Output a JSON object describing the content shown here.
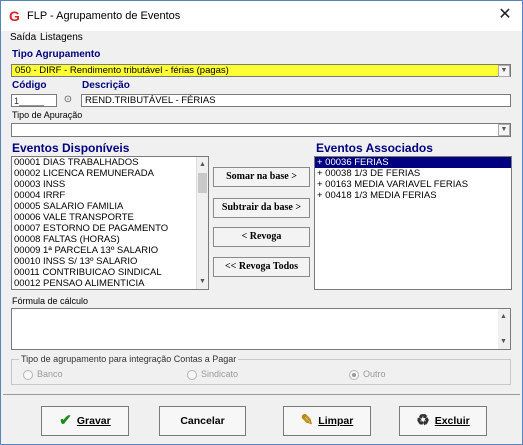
{
  "window": {
    "title": "FLP - Agrupamento de Eventos",
    "app_icon": "G",
    "close_glyph": "✕"
  },
  "menu": {
    "items": [
      "Saída",
      "Listagens"
    ]
  },
  "tipo_agrupamento": {
    "label": "Tipo Agrupamento",
    "value": "050 - DIRF - Rendimento tributável - férias (pagas)"
  },
  "codigo": {
    "label": "Código",
    "value": "1_____"
  },
  "descricao": {
    "label": "Descrição",
    "value": "REND.TRIBUTÁVEL - FÉRIAS"
  },
  "tipo_apuracao": {
    "label": "Tipo de Apuração",
    "value": ""
  },
  "eventos_disponiveis": {
    "title": "Eventos Disponíveis",
    "items": [
      "00001 DIAS TRABALHADOS",
      "00002 LICENCA REMUNERADA",
      "00003 INSS",
      "00004 IRRF",
      "00005 SALARIO FAMILIA",
      "00006 VALE TRANSPORTE",
      "00007 ESTORNO DE PAGAMENTO",
      "00008 FALTAS (HORAS)",
      "00009 1ª PARCELA 13º SALARIO",
      "00010 INSS S/ 13º SALARIO",
      "00011 CONTRIBUICAO SINDICAL",
      "00012 PENSAO ALIMENTICIA"
    ]
  },
  "eventos_associados": {
    "title": "Eventos Associados",
    "items": [
      "+ 00036 FERIAS",
      "+ 00038 1/3 DE FERIAS",
      "+ 00163 MEDIA VARIAVEL FERIAS",
      "+ 00418 1/3 MEDIA FERIAS"
    ],
    "selected_index": 0
  },
  "actions": {
    "somar": "Somar  na base >",
    "subtrair": "Subtrair da base >",
    "revoga": "< Revoga",
    "revoga_todos": "<< Revoga Todos"
  },
  "formula": {
    "label": "Fórmula de cálculo",
    "value": ""
  },
  "integracao": {
    "label": "Tipo de agrupamento para integração Contas a Pagar",
    "options": [
      "Banco",
      "Sindicato",
      "Outro"
    ],
    "selected": "Outro"
  },
  "footer": {
    "gravar": "Gravar",
    "cancelar": "Cancelar",
    "limpar": "Limpar",
    "excluir": "Excluir"
  },
  "icons": {
    "gravar": "checkmark-icon",
    "limpar": "broom-icon",
    "excluir": "trash-icon",
    "search": "binoculars-icon"
  },
  "colors": {
    "accent": "#000080",
    "highlight": "#ffff33",
    "check": "#1a8c1a"
  }
}
